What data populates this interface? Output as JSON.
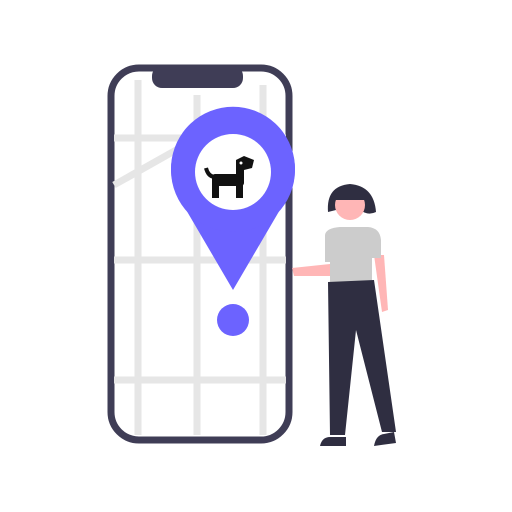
{
  "illustration": {
    "subject": "phone-map-pet-location",
    "icons": [
      "phone-icon",
      "map-pin-icon",
      "dog-icon",
      "person-figure"
    ],
    "colors": {
      "accent": "#6c63ff",
      "phone_frame": "#3f3d56",
      "map_roads": "#e6e6e6",
      "pants": "#2f2e41",
      "skin": "#ffb6b6",
      "shirt": "#cccccc"
    }
  }
}
